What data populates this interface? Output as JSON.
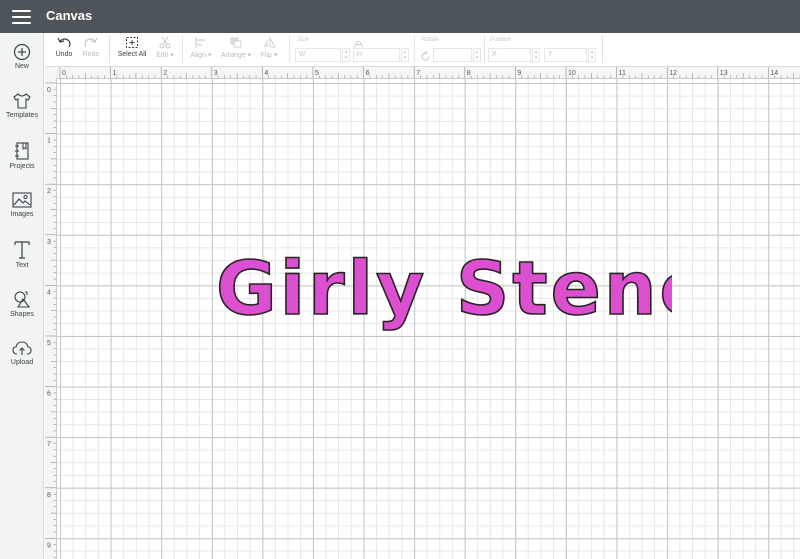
{
  "header": {
    "title": "Canvas"
  },
  "sidebar": {
    "items": [
      {
        "id": "new",
        "label": "New",
        "icon": "plus-circle-icon"
      },
      {
        "id": "templates",
        "label": "Templates",
        "icon": "tshirt-icon"
      },
      {
        "id": "projects",
        "label": "Projects",
        "icon": "notebook-icon"
      },
      {
        "id": "images",
        "label": "Images",
        "icon": "image-icon"
      },
      {
        "id": "text",
        "label": "Text",
        "icon": "text-t-icon"
      },
      {
        "id": "shapes",
        "label": "Shapes",
        "icon": "shapes-icon"
      },
      {
        "id": "upload",
        "label": "Upload",
        "icon": "cloud-upload-icon"
      }
    ]
  },
  "toolbar": {
    "undo_label": "Undo",
    "redo_label": "Redo",
    "select_all_label": "Select All",
    "edit_label": "Edit",
    "align_label": "Align",
    "arrange_label": "Arrange",
    "flip_label": "Flip",
    "size_label": "Size",
    "width_field": "W",
    "height_field": "H",
    "rotate_label": "Rotate",
    "position_label": "Position",
    "x_field": "X",
    "y_field": "Y"
  },
  "rulers": {
    "horizontal": [
      "0",
      "1",
      "2",
      "3",
      "4",
      "5",
      "6",
      "7",
      "8",
      "9",
      "10",
      "11",
      "12",
      "13",
      "14"
    ],
    "vertical": [
      "0",
      "1",
      "2",
      "3",
      "4",
      "5",
      "6",
      "7",
      "8",
      "9"
    ]
  },
  "canvas": {
    "text": "Girly Stencil",
    "fill_color": "#dc4fd0",
    "stroke_color": "#2a2326"
  },
  "colors": {
    "header_bg": "#4d545a",
    "sidebar_bg": "#f2f3f3",
    "accent": "#dc4fd0"
  }
}
